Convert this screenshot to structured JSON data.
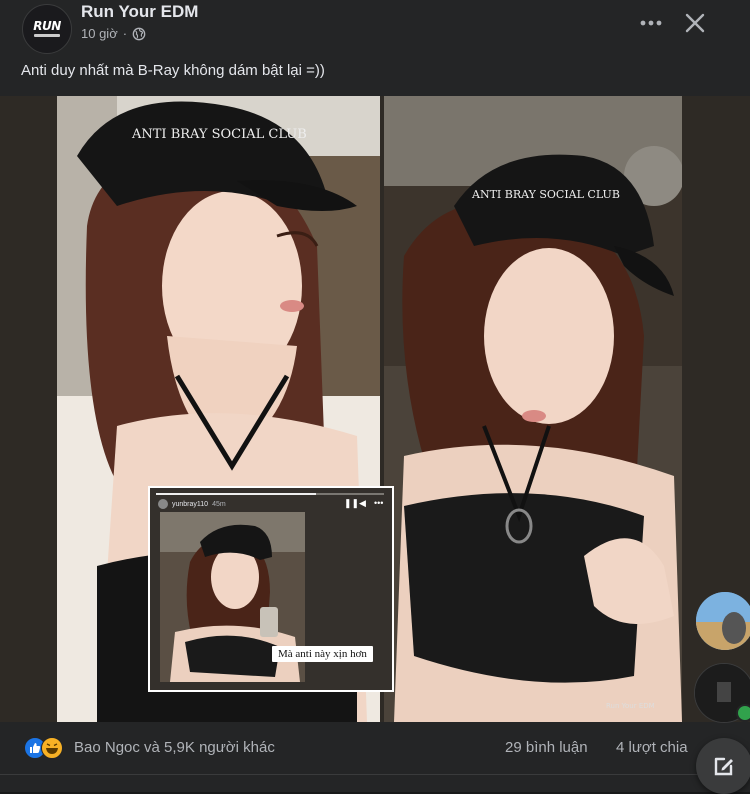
{
  "post": {
    "page_name": "Run Your EDM",
    "avatar_logo_text": "RUN",
    "timestamp": "10 giờ",
    "separator": "·",
    "caption": "Anti duy nhất mà B-Ray không dám bật lại =))",
    "icons": {
      "privacy": "globe-icon",
      "more": "more-dots-icon",
      "close": "close-icon"
    }
  },
  "media": {
    "left_cap_text": "ANTI BRAY SOCIAL CLUB",
    "right_cap_text": "ANTI BRAY SOCIAL CLUB",
    "watermark": "Run Your EDM",
    "story": {
      "username": "yunbray110",
      "time": "45m",
      "overlay_text": "Mà anti này xịn hơn",
      "controls": [
        "pause-icon",
        "volume-icon",
        "more-dots-icon"
      ]
    }
  },
  "reactions": {
    "summary": "Bao Ngoc và 5,9K người khác",
    "comments": "29 bình luận",
    "shares": "4 lượt chia",
    "types": [
      "like",
      "haha"
    ],
    "colors": {
      "like": "#1b74e4",
      "haha": "#f7b125"
    }
  },
  "sidebar": {
    "compose_icon": "compose-icon"
  }
}
